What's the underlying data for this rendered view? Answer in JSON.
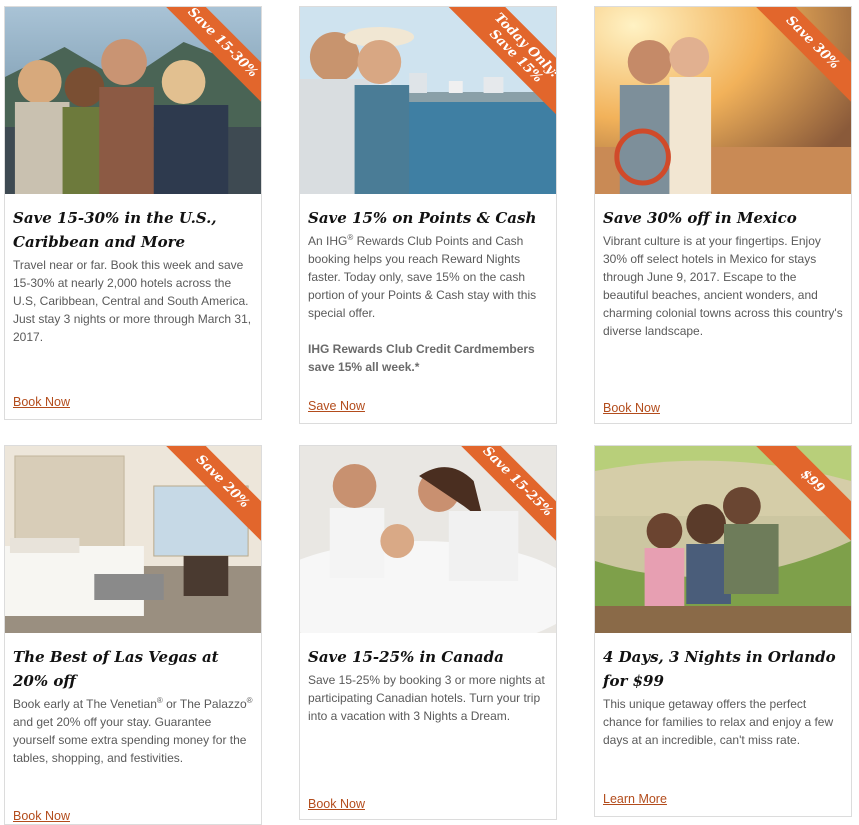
{
  "colors": {
    "ribbon": "#e2662c",
    "link": "#b34c1c",
    "border": "#dcdcdc"
  },
  "cards": [
    {
      "ribbon": "Save 15-30%",
      "title": "Save 15-30% in the U.S., Caribbean and More",
      "desc": "Travel near or far. Book this week and save 15-30% at nearly 2,000 hotels across the U.S, Caribbean, Central and South America. Just stay 3 nights or more through March 31, 2017.",
      "cta": "Book Now"
    },
    {
      "ribbon_line1": "Today Only:",
      "ribbon_line2": "Save 15%",
      "title": "Save 15% on Points & Cash",
      "desc_a": "An IHG",
      "reg": "®",
      "desc_b": " Rewards Club Points and Cash booking helps you reach Reward Nights faster. Today only, save 15% on the cash portion of your Points & Cash stay with this special offer.",
      "bold_note": "IHG Rewards Club Credit Cardmembers save 15% all week.*",
      "cta": "Save Now"
    },
    {
      "ribbon": "Save 30%",
      "title": "Save 30% off in Mexico",
      "desc": "Vibrant culture is at your fingertips. Enjoy 30% off select hotels in Mexico for stays through June 9, 2017. Escape to the beautiful beaches, ancient wonders, and charming colonial towns across this country's diverse landscape.",
      "cta": "Book Now"
    },
    {
      "ribbon": "Save 20%",
      "title": "The Best of Las Vegas at 20% off",
      "desc_a": "Book early at The Venetian",
      "reg": "®",
      "desc_b": " or The Palazzo",
      "desc_c": " and get 20% off your stay. Guarantee yourself some extra spending money for the tables, shopping, and festivities.",
      "cta": "Book Now"
    },
    {
      "ribbon": "Save 15-25%",
      "title": "Save 15-25% in Canada",
      "desc": "Save 15-25% by booking 3 or more nights at participating Canadian hotels. Turn your trip into a vacation with 3 Nights a Dream.",
      "cta": "Book Now"
    },
    {
      "ribbon": "$99",
      "title": "4 Days, 3 Nights in Orlando for $99",
      "desc": "This unique getaway offers the perfect chance for families to relax and enjoy a few days at an incredible, can't miss rate.",
      "cta": "Learn More"
    }
  ]
}
